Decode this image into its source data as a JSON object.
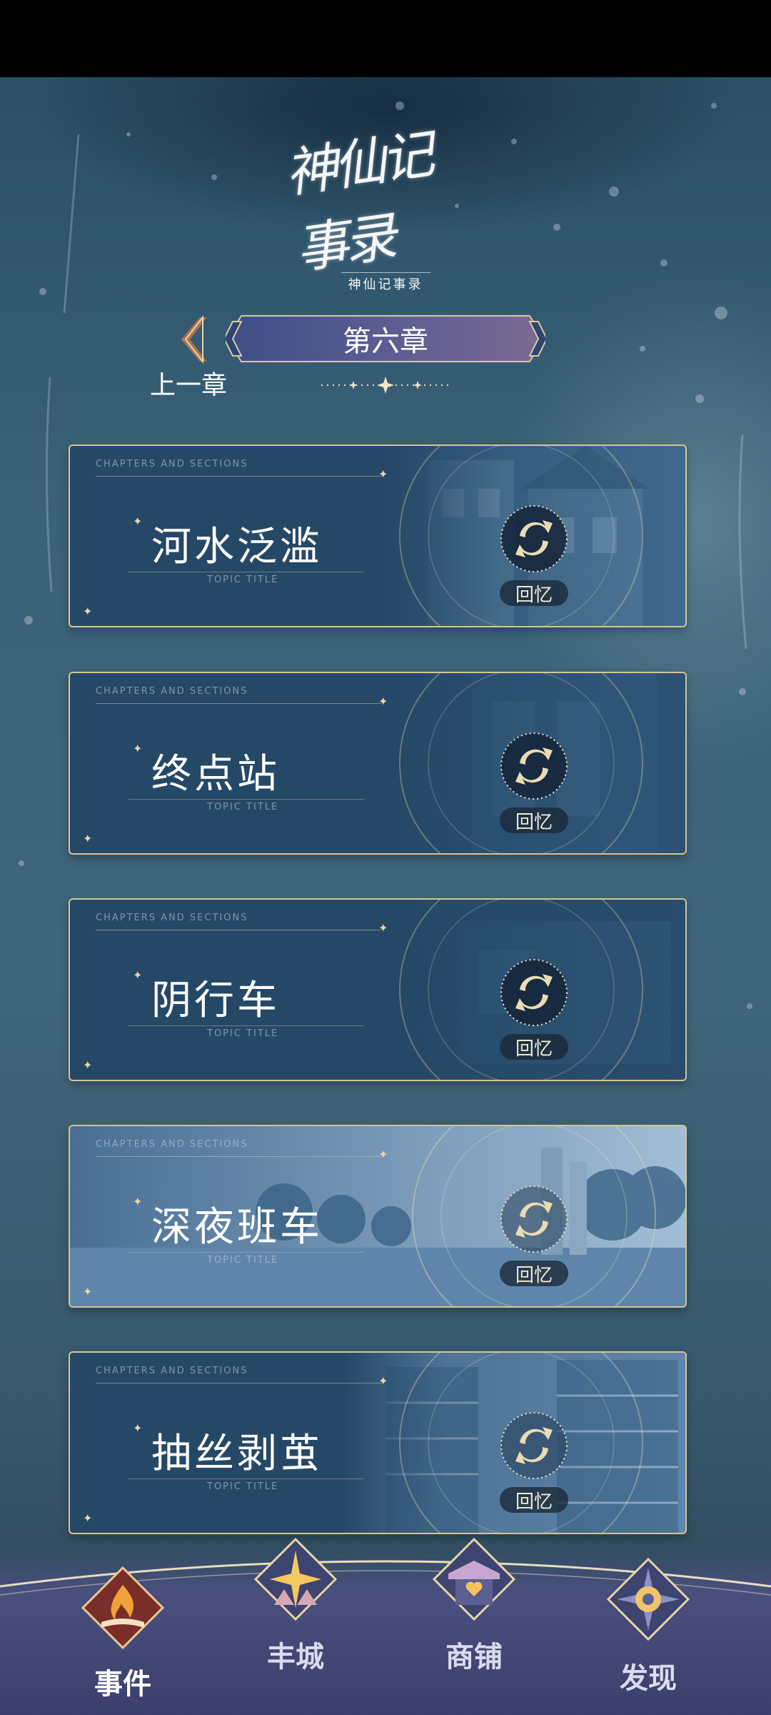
{
  "logo": {
    "script": "神仙记事录",
    "subtitle": "神仙记事录"
  },
  "navigation": {
    "prev_label": "上一章",
    "chapter_title": "第六章"
  },
  "card_labels": {
    "header": "CHAPTERS AND SECTIONS",
    "topic": "TOPIC TITLE"
  },
  "episodes": [
    {
      "title": "河水泛滥",
      "action": "回忆"
    },
    {
      "title": "终点站",
      "action": "回忆"
    },
    {
      "title": "阴行车",
      "action": "回忆"
    },
    {
      "title": "深夜班车",
      "action": "回忆"
    },
    {
      "title": "抽丝剥茧",
      "action": "回忆"
    }
  ],
  "tabs": [
    {
      "label": "事件",
      "icon": "flame-book-icon",
      "active": true
    },
    {
      "label": "丰城",
      "icon": "star-castle-icon",
      "active": false
    },
    {
      "label": "商铺",
      "icon": "shop-heart-icon",
      "active": false
    },
    {
      "label": "发现",
      "icon": "compass-icon",
      "active": false
    }
  ],
  "colors": {
    "frame_gold": "#d8c393",
    "card_blue": "#254867",
    "text_white": "#ffffff",
    "nav_purple": "#3c3f6b"
  }
}
